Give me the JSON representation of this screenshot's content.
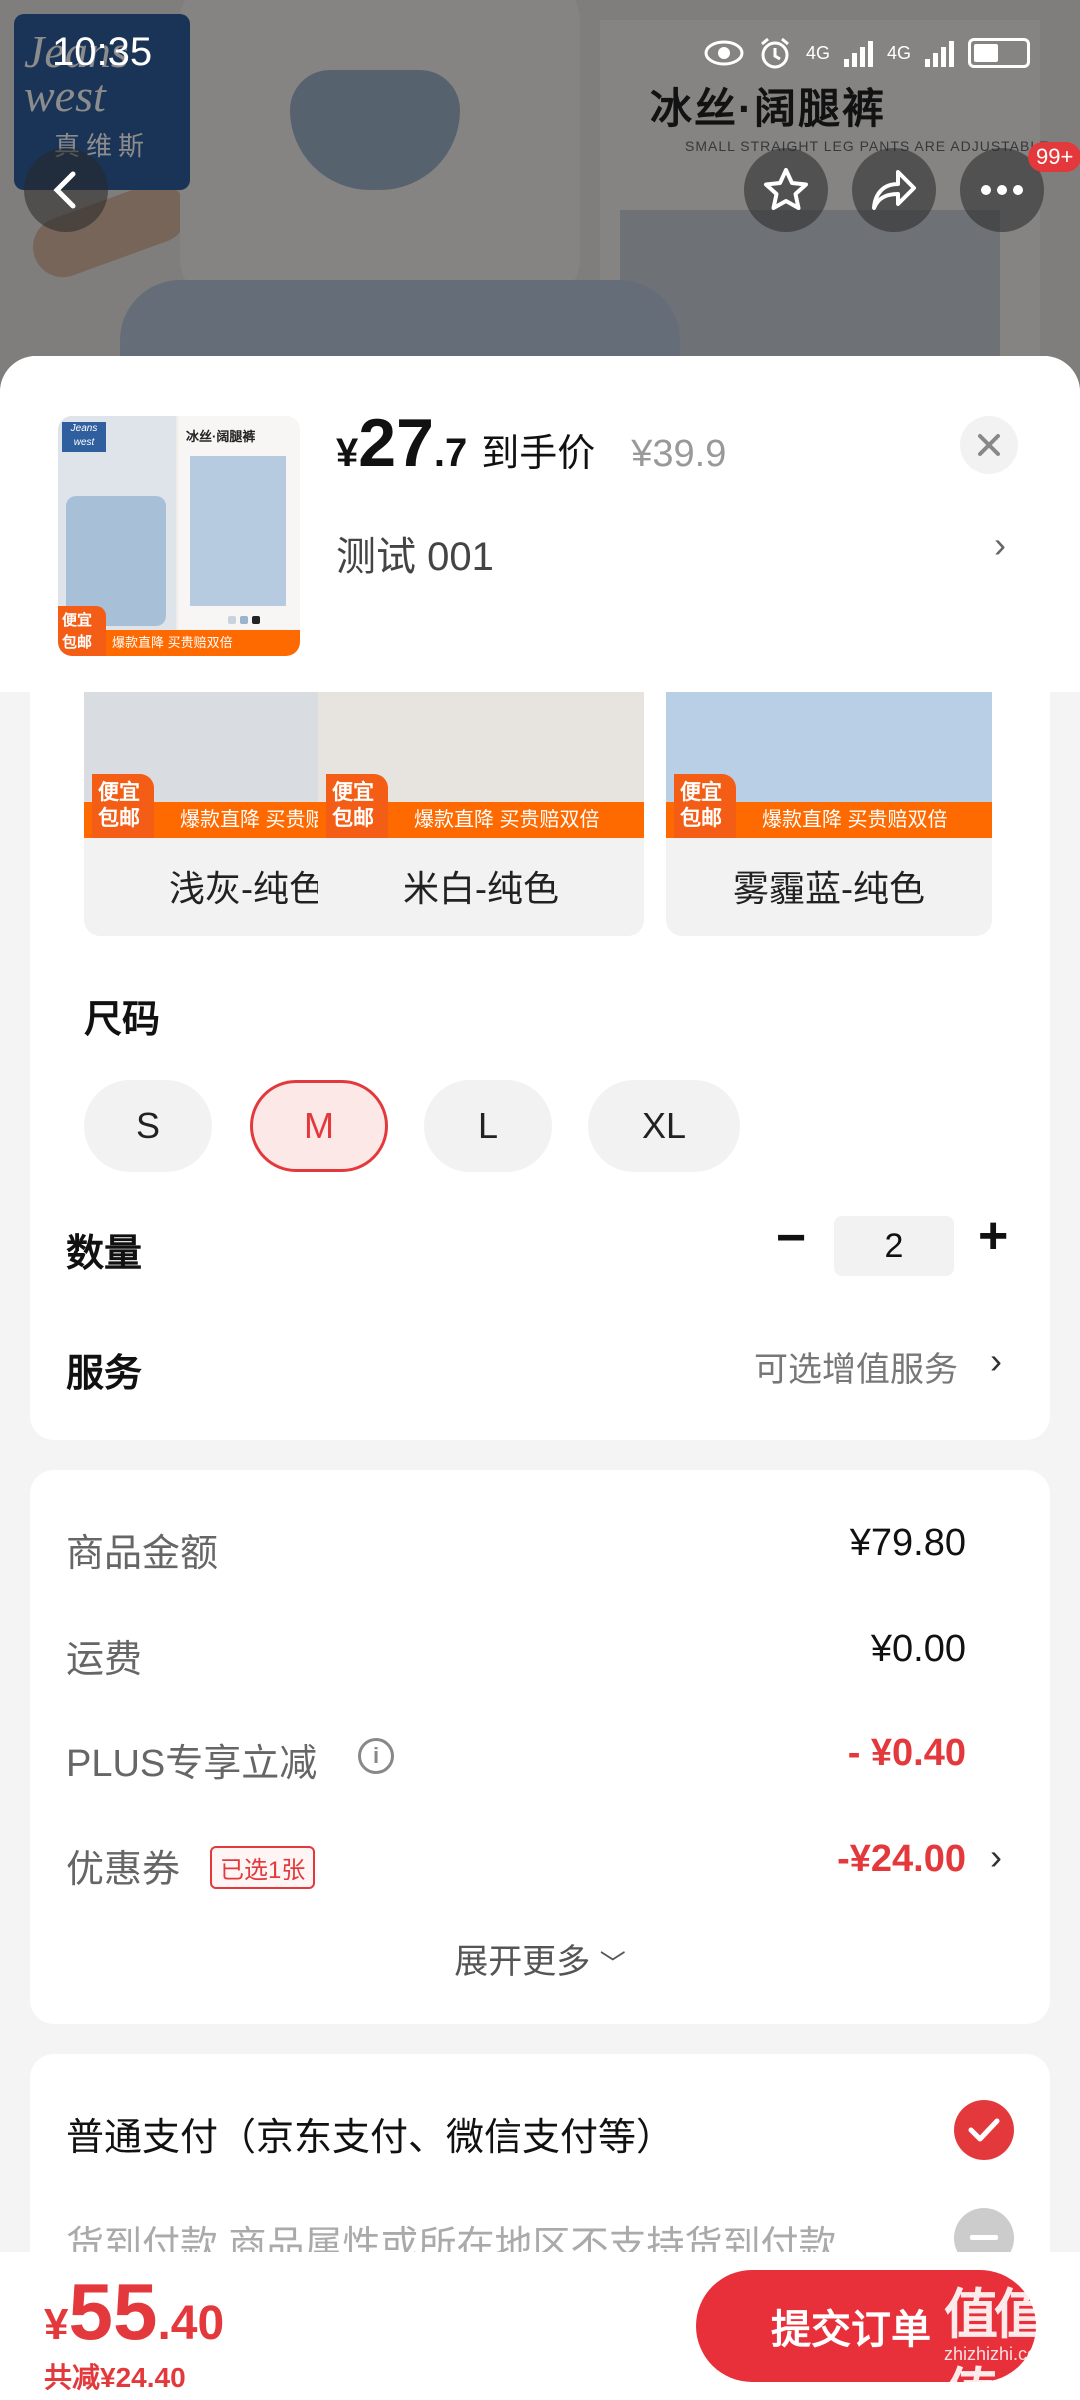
{
  "status_bar": {
    "time": "10:35",
    "network_1": "4G",
    "network_2": "4G"
  },
  "hero": {
    "brand_line1": "Jeans",
    "brand_line2": "west",
    "brand_cn": "真维斯",
    "right_title": "冰丝·阔腿裤",
    "right_sub": "SMALL STRAIGHT LEG PANTS ARE ADJUSTABLE",
    "cart_badge": "99+"
  },
  "sheet": {
    "thumb": {
      "title": "冰丝·阔腿裤",
      "tag": "便宜包邮",
      "strip": "爆款直降 买贵赔双倍",
      "logo": "Jeans west"
    },
    "price": {
      "symbol": "¥",
      "int": "27",
      "dec": ".7",
      "label": "到手价",
      "original": "¥39.9"
    },
    "selected_spec": "测试  001",
    "colors": [
      {
        "name": "浅灰-纯色",
        "tag": "便宜包邮",
        "strip": "爆款直降  买贵赔双倍",
        "img_color": "#d9dde2"
      },
      {
        "name": "米白-纯色",
        "tag": "便宜包邮",
        "strip": "爆款直降  买贵赔双倍",
        "img_color": "#e7e3de"
      },
      {
        "name": "雾霾蓝-纯色",
        "tag": "便宜包邮",
        "strip": "爆款直降  买贵赔双倍",
        "img_color": "#b9cfe6"
      }
    ],
    "size_label": "尺码",
    "sizes": [
      "S",
      "M",
      "L",
      "XL"
    ],
    "selected_size": "M",
    "quantity_label": "数量",
    "quantity": "2",
    "service_label": "服务",
    "service_hint": "可选增值服务"
  },
  "fees": {
    "goods_label": "商品金额",
    "goods_value": "¥79.80",
    "shipping_label": "运费",
    "shipping_value": "¥0.00",
    "plus_label": "PLUS专享立减",
    "plus_value": "- ¥0.40",
    "coupon_label": "优惠券",
    "coupon_tag": "已选1张",
    "coupon_value": "-¥24.00",
    "expand_more": "展开更多"
  },
  "payment": {
    "normal": "普通支付（京东支付、微信支付等）",
    "cod": "货到付款  商品属性或所在地区不支持货到付款"
  },
  "bottom": {
    "total_symbol": "¥",
    "total_int": "55",
    "total_dec": ".40",
    "saved": "共减¥24.40",
    "submit": "提交订单"
  },
  "watermark": {
    "text": "值值值",
    "sub": "zhizhizhi.com"
  },
  "colors": {
    "accent": "#e4393c",
    "orange": "#ff6a00",
    "brand_blue": "#2f5f9e"
  }
}
